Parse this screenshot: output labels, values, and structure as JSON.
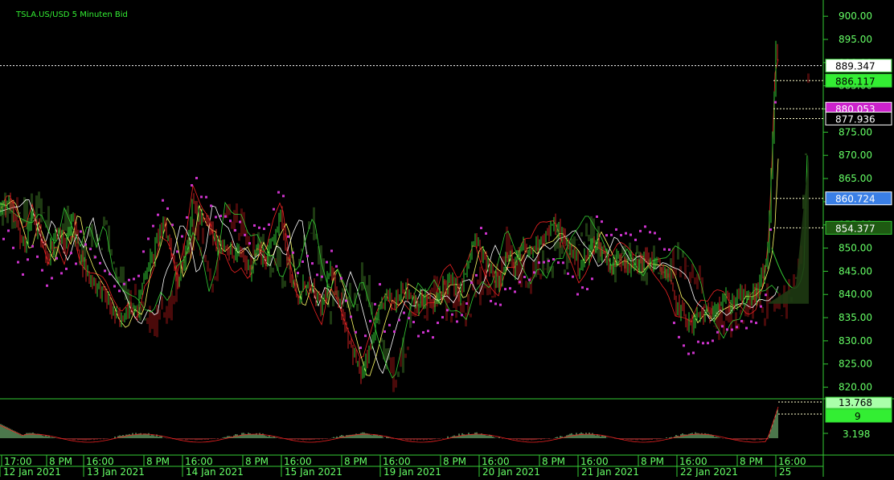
{
  "chart_title": "TSLA.US/USD  5 Minuten Bid",
  "colors": {
    "background": "#000000",
    "grid_axis": "#33cc33",
    "axis_text": "#66ff66",
    "bull_candle": "#33cc33",
    "bear_candle": "#cc2222",
    "psar": "#cc33cc",
    "kumo_bull": "#1e3a12",
    "kumo_bear": "#4a0a0a",
    "price_line": "#ffffff"
  },
  "price_axis": {
    "ticks": [
      "900.00",
      "895.00",
      "890.00",
      "885.00",
      "880.00",
      "875.00",
      "870.00",
      "865.00",
      "860.00",
      "855.00",
      "850.00",
      "845.00",
      "840.00",
      "835.00",
      "830.00",
      "825.00",
      "820.00"
    ],
    "range": [
      817.5,
      903.5
    ]
  },
  "price_labels": [
    {
      "value": 889.347,
      "text": "889.347",
      "bg": "#ffffff",
      "fg": "#000000",
      "border": "#33cc33"
    },
    {
      "value": 886.117,
      "text": "886.117",
      "bg": "#33ee33",
      "fg": "#000000",
      "border": "#33cc33"
    },
    {
      "value": 880.053,
      "text": "880.053",
      "bg": "#cc22cc",
      "fg": "#ffffff",
      "border": "#ffffff"
    },
    {
      "value": 877.936,
      "text": "877.936",
      "bg": "#000000",
      "fg": "#ffffff",
      "border": "#ffffff"
    },
    {
      "value": 860.724,
      "text": "860.724",
      "bg": "#3a7fe6",
      "fg": "#ffffff",
      "border": "#ffffff"
    },
    {
      "value": 854.377,
      "text": "854.377",
      "bg": "#1e5a12",
      "fg": "#ffffff",
      "border": "#33cc33"
    }
  ],
  "oscillator": {
    "ticks": [
      "3.198"
    ],
    "labels": [
      {
        "text": "13.768",
        "bg": "#aaffaa",
        "fg": "#000000"
      },
      {
        "text": "9",
        "bg": "#33ee33",
        "fg": "#000000"
      }
    ]
  },
  "time_axis": {
    "upper": [
      "17:00",
      "8 PM",
      "16:00",
      "8 PM",
      "16:00",
      "8 PM",
      "16:00",
      "8 PM",
      "16:00",
      "8 PM",
      "16:00",
      "8 PM",
      "16:00",
      "8 PM",
      "16:00",
      "8 PM",
      "16:00"
    ],
    "lower": [
      "12 Jan 2021",
      "13 Jan 2021",
      "14 Jan 2021",
      "15 Jan 2021",
      "19 Jan 2021",
      "20 Jan 2021",
      "21 Jan 2021",
      "22 Jan 2021",
      "25"
    ]
  },
  "chart_data": {
    "type": "candlestick",
    "title": "TSLA.US/USD  5 Minuten Bid",
    "ylim": [
      817.5,
      903.5
    ],
    "close_path": [
      [
        0,
        858
      ],
      [
        10,
        860
      ],
      [
        20,
        855
      ],
      [
        30,
        850
      ],
      [
        40,
        857
      ],
      [
        50,
        852
      ],
      [
        60,
        848
      ],
      [
        70,
        854
      ],
      [
        80,
        850
      ],
      [
        90,
        857
      ],
      [
        100,
        848
      ],
      [
        110,
        844
      ],
      [
        120,
        842
      ],
      [
        130,
        840
      ],
      [
        140,
        836
      ],
      [
        150,
        834
      ],
      [
        160,
        838
      ],
      [
        170,
        836
      ],
      [
        180,
        845
      ],
      [
        190,
        848
      ],
      [
        200,
        855
      ],
      [
        210,
        852
      ],
      [
        220,
        843
      ],
      [
        230,
        848
      ],
      [
        240,
        860
      ],
      [
        250,
        856
      ],
      [
        260,
        855
      ],
      [
        270,
        850
      ],
      [
        280,
        851
      ],
      [
        290,
        848
      ],
      [
        300,
        849
      ],
      [
        310,
        845
      ],
      [
        320,
        850
      ],
      [
        330,
        847
      ],
      [
        340,
        853
      ],
      [
        350,
        857
      ],
      [
        360,
        845
      ],
      [
        370,
        838
      ],
      [
        380,
        843
      ],
      [
        390,
        840
      ],
      [
        400,
        837
      ],
      [
        410,
        845
      ],
      [
        420,
        840
      ],
      [
        430,
        833
      ],
      [
        440,
        827
      ],
      [
        450,
        822
      ],
      [
        460,
        828
      ],
      [
        470,
        835
      ],
      [
        480,
        840
      ],
      [
        490,
        838
      ],
      [
        500,
        842
      ],
      [
        510,
        840
      ],
      [
        520,
        838
      ],
      [
        530,
        839
      ],
      [
        540,
        837
      ],
      [
        550,
        842
      ],
      [
        560,
        843
      ],
      [
        570,
        840
      ],
      [
        580,
        845
      ],
      [
        590,
        852
      ],
      [
        600,
        848
      ],
      [
        610,
        845
      ],
      [
        620,
        843
      ],
      [
        630,
        848
      ],
      [
        640,
        846
      ],
      [
        650,
        850
      ],
      [
        660,
        849
      ],
      [
        670,
        852
      ],
      [
        680,
        853
      ],
      [
        690,
        855
      ],
      [
        700,
        852
      ],
      [
        710,
        850
      ],
      [
        720,
        846
      ],
      [
        730,
        848
      ],
      [
        740,
        852
      ],
      [
        750,
        849
      ],
      [
        760,
        846
      ],
      [
        770,
        848
      ],
      [
        780,
        847
      ],
      [
        790,
        846
      ],
      [
        800,
        848
      ],
      [
        810,
        847
      ],
      [
        820,
        846
      ],
      [
        830,
        844
      ],
      [
        840,
        838
      ],
      [
        850,
        836
      ],
      [
        860,
        833
      ],
      [
        870,
        836
      ],
      [
        880,
        835
      ],
      [
        890,
        838
      ],
      [
        900,
        839
      ],
      [
        910,
        838
      ],
      [
        920,
        840
      ],
      [
        930,
        839
      ],
      [
        940,
        840
      ],
      [
        950,
        845
      ],
      [
        955,
        850
      ],
      [
        960,
        868
      ],
      [
        965,
        892
      ],
      [
        968,
        889.347
      ]
    ],
    "oscillator_last": 13.768,
    "oscillator_signal": 9,
    "oscillator_mid_tick": 3.198
  }
}
